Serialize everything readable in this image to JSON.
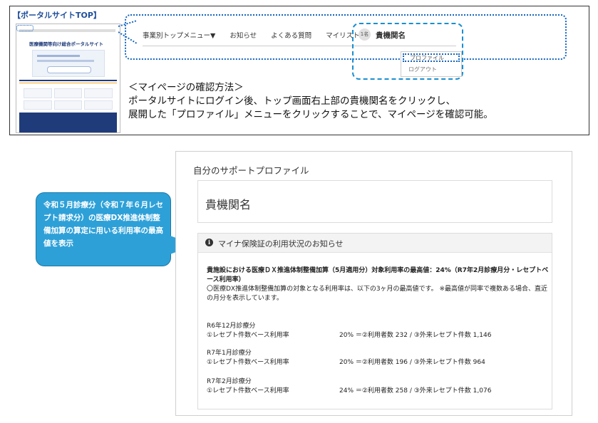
{
  "top_panel": {
    "portal_tag": "【ポータルサイトTOP】",
    "thumb_title": "医療機関等向け総合ポータルサイト",
    "nav": [
      "事業別トップメニュー▼",
      "お知らせ",
      "よくある質問",
      "マイリスト▼"
    ],
    "avatar": "1名",
    "org_name": "貴機関名",
    "dropdown_profile": "プロファイル",
    "dropdown_logout": "ログアウト",
    "howto": [
      "＜マイページの確認方法＞",
      "ポータルサイトにログイン後、トップ画面右上部の貴機関名をクリックし、",
      "展開した「プロファイル」メニューをクリックすることで、マイページを確認可能。"
    ]
  },
  "callout": {
    "text": "令和５月診療分（令和７年６月レセプト請求分）の医療DX推進体制整備加算の算定に用いる利用率の最高値を表示"
  },
  "profile": {
    "title": "自分のサポートプロファイル",
    "org_name": "貴機関名",
    "notice_title": "マイナ保険証の利用状況のお知らせ",
    "bold_line": "貴施設における医療ＤＸ推進体制整備加算（5月適用分）対象利用率の最高値：24%（R7年2月診療月分・レセプトベース利用率）",
    "description": "〇医療DX推進体制整備加算の対象となる利用率は、以下の3ヶ月の最高値です。 ※最高値が同率で複数ある場合、直近の月分を表示しています。",
    "months": [
      {
        "month": "R6年12月診療分",
        "label": "①レセプト件数ベース利用率",
        "value": "20% ＝②利用者数 232 / ③外来レセプト件数 1,146"
      },
      {
        "month": "R7年1月診療分",
        "label": "①レセプト件数ベース利用率",
        "value": "20% ＝②利用者数 196 / ③外来レセプト件数 964"
      },
      {
        "month": "R7年2月診療分",
        "label": "①レセプト件数ベース利用率",
        "value": "24% ＝②利用者数 258 / ③外来レセプト件数 1,076"
      }
    ]
  }
}
